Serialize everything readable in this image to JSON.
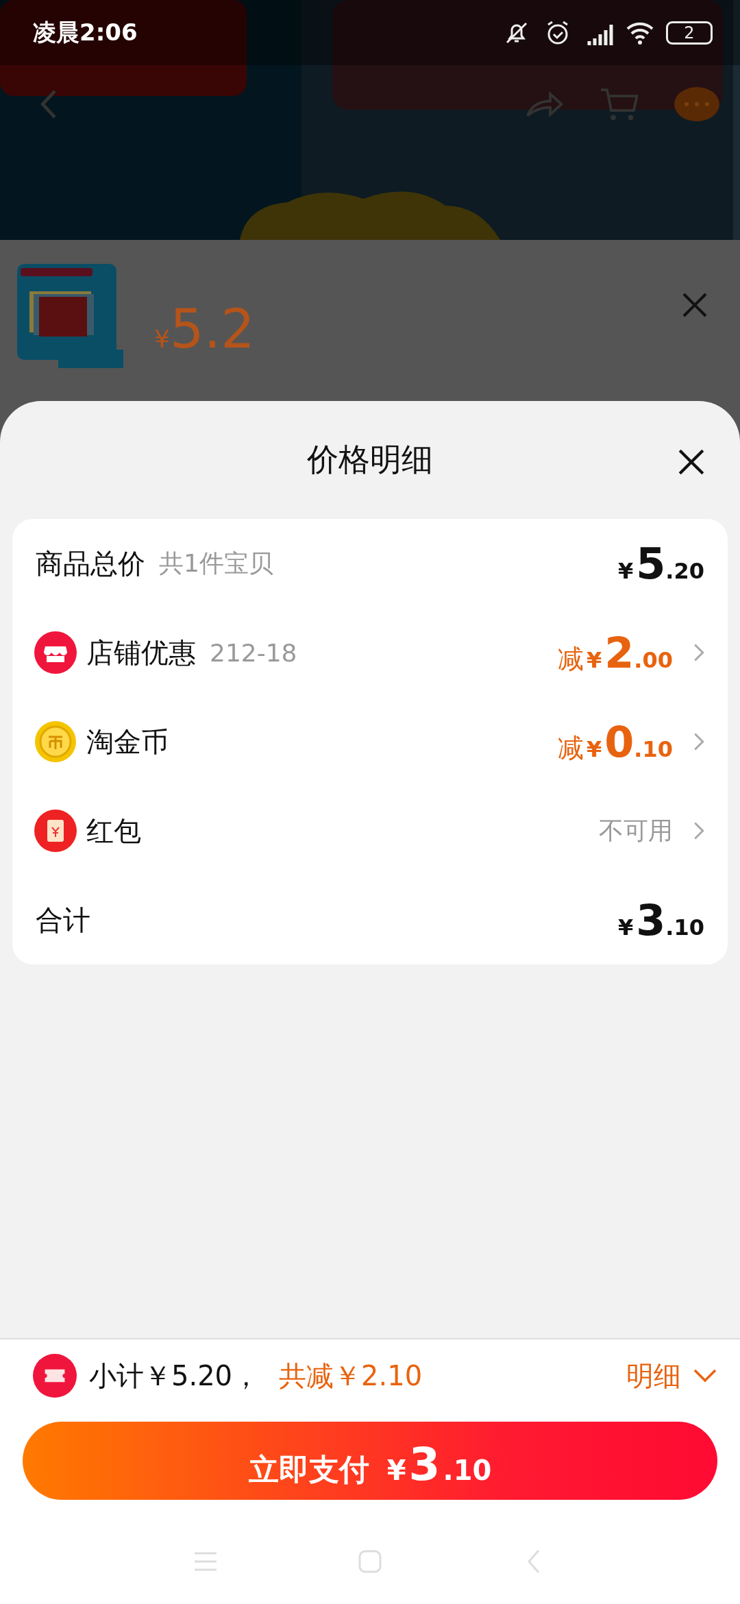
{
  "status_bar": {
    "time": "凌晨2:06",
    "battery": "2"
  },
  "product": {
    "currency": "¥",
    "price": "5.2"
  },
  "sheet": {
    "title": "价格明细",
    "rows": [
      {
        "kind": "price",
        "label": "商品总价",
        "note": "共1件宝贝",
        "value": {
          "currency": "¥",
          "integer": "5",
          "decimal": ".20"
        },
        "arrow": false
      },
      {
        "kind": "discount",
        "label": "店铺优惠",
        "note": "212-18",
        "value": {
          "prefix": "减",
          "currency": "¥",
          "integer": "2",
          "decimal": ".00"
        },
        "arrow": true
      },
      {
        "kind": "discount",
        "label": "淘金币",
        "value": {
          "prefix": "减",
          "currency": "¥",
          "integer": "0",
          "decimal": ".10"
        },
        "arrow": true
      },
      {
        "kind": "status",
        "label": "红包",
        "value": {
          "text": "不可用"
        },
        "arrow": true
      },
      {
        "kind": "price",
        "label": "合计",
        "value": {
          "currency": "¥",
          "integer": "3",
          "decimal": ".10"
        },
        "arrow": false
      }
    ]
  },
  "footer": {
    "subtotal": "小计￥5.20，",
    "saved": "共减￥2.10",
    "details_link": "明细",
    "pay_button": {
      "label": "立即支付",
      "currency": "¥",
      "integer": "3",
      "decimal": ".10"
    }
  }
}
